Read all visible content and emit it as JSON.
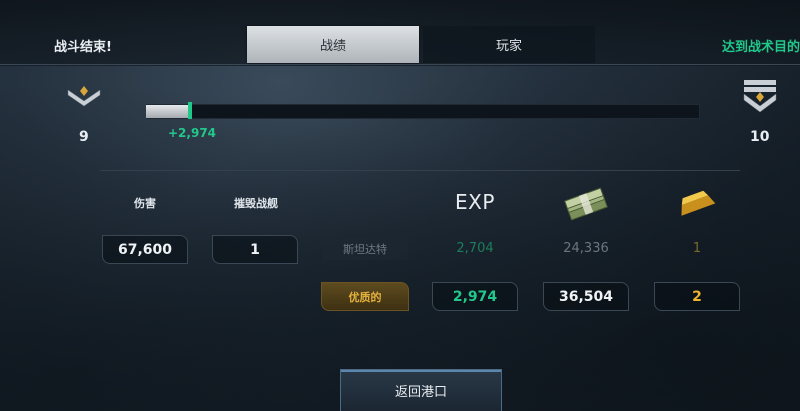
{
  "header": {
    "battle_status": "战斗结束!",
    "objective_status": "达到战术目的",
    "tabs": [
      {
        "label": "战绩",
        "active": true
      },
      {
        "label": "玩家",
        "active": false
      }
    ]
  },
  "progress": {
    "current_rank": "9",
    "next_rank": "10",
    "xp_gain": "+2,974",
    "fill_fraction": 0.08,
    "current_rank_icon": "rank-chevron-icon",
    "next_rank_icon": "rank-double-chevron-icon"
  },
  "stats": {
    "damage_label": "伤害",
    "kills_label": "摧毁战舰",
    "damage_value": "67,600",
    "kills_value": "1"
  },
  "rewards": {
    "exp_label": "EXP",
    "cash_icon": "cash-stack-icon",
    "gold_icon": "gold-bar-icon",
    "ship_name": "斯坦达特",
    "base": {
      "exp": "2,704",
      "cash": "24,336",
      "gold": "1"
    },
    "premium_label": "优质的",
    "premium": {
      "exp": "2,974",
      "cash": "36,504",
      "gold": "2"
    }
  },
  "footer": {
    "return_label": "返回港口"
  },
  "colors": {
    "accent_green": "#22c88b",
    "gold": "#f0b330",
    "premium_bg": "#5e4b1f"
  }
}
